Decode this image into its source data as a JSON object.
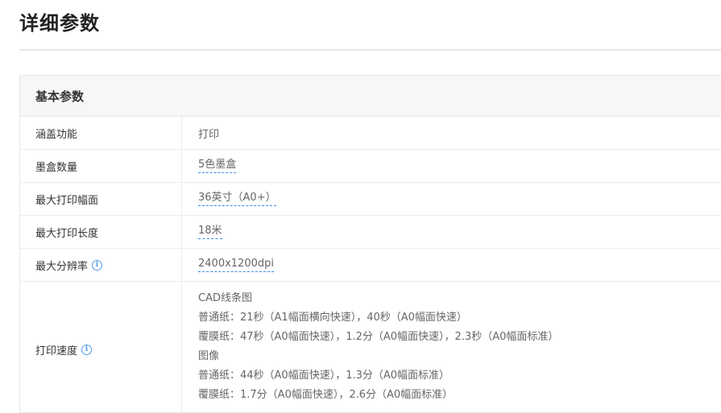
{
  "page": {
    "title": "详细参数"
  },
  "section": {
    "header": "基本参数"
  },
  "rows": [
    {
      "label": "涵盖功能",
      "value": "打印"
    },
    {
      "label": "墨盒数量",
      "value": "5色墨盒"
    },
    {
      "label": "最大打印幅面",
      "value": "36英寸（A0+）"
    },
    {
      "label": "最大打印长度",
      "value": "18米"
    },
    {
      "label": "最大分辨率",
      "value": "2400x1200dpi"
    }
  ],
  "speed": {
    "label": "打印速度",
    "lines": [
      "CAD线条图",
      "普通纸：21秒（A1幅面横向快速），40秒（A0幅面快速）",
      "覆膜纸：47秒（A0幅面快速），1.2分（A0幅面快速），2.3秒（A0幅面标准）",
      "图像",
      "普通纸：44秒（A0幅面快速），1.3分（A0幅面标准）",
      "覆膜纸：1.7分（A0幅面快速），2.6分（A0幅面标准）"
    ]
  },
  "icons": {
    "info": "info-icon",
    "info_color": "#4d9ce6",
    "link_underline_color": "#3b8be6"
  }
}
